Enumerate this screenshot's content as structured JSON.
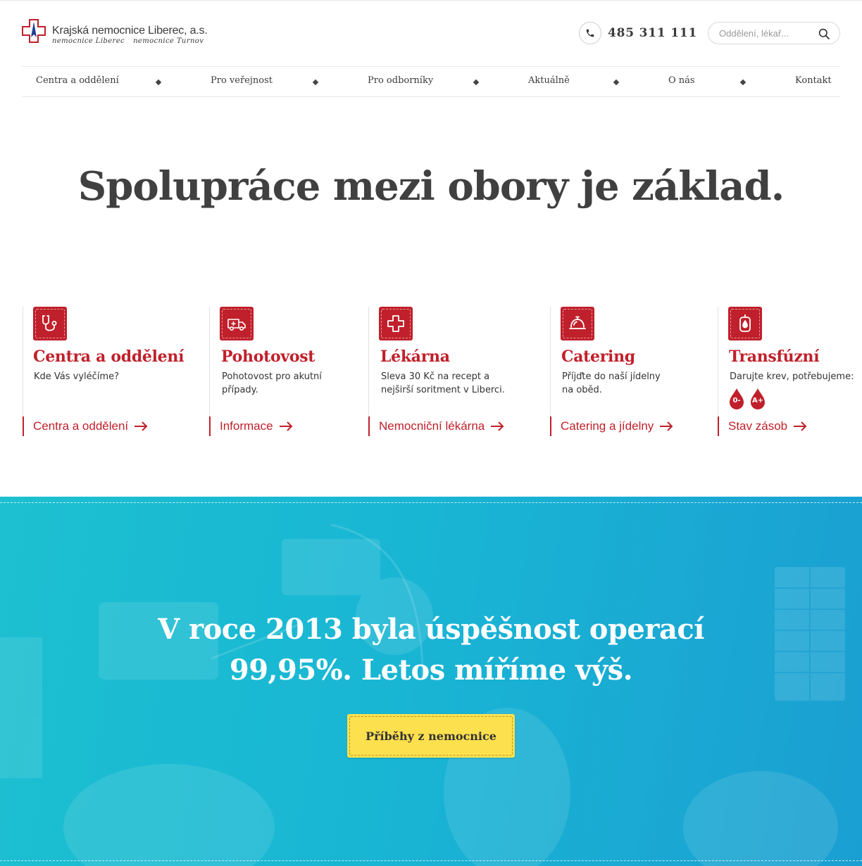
{
  "header": {
    "logo_title": "Krajská nemocnice Liberec, a.s.",
    "logo_sub": [
      "nemocnice Liberec",
      "nemocnice Turnov"
    ],
    "phone": "485 311 111",
    "search_placeholder": "Oddělení, lékař..."
  },
  "nav": {
    "items": [
      {
        "label": "Centra a oddělení"
      },
      {
        "label": "Pro veřejnost"
      },
      {
        "label": "Pro odborníky"
      },
      {
        "label": "Aktuálně"
      },
      {
        "label": "O nás"
      },
      {
        "label": "Kontakt"
      }
    ]
  },
  "hero": {
    "title": "Spolupráce mezi obory je základ."
  },
  "cards": [
    {
      "icon": "stethoscope-icon",
      "title": "Centra a oddělení",
      "desc": [
        "Kde Vás vyléčíme?"
      ],
      "link": "Centra a oddělení"
    },
    {
      "icon": "ambulance-icon",
      "title": "Pohotovost",
      "desc": [
        "Pohotovost pro akutní",
        "případy."
      ],
      "link": "Informace"
    },
    {
      "icon": "medical-cross-icon",
      "title": "Lékárna",
      "desc": [
        "Sleva 30 Kč na recept a",
        "nejširší soritment v Liberci."
      ],
      "link": "Nemocniční lékárna"
    },
    {
      "icon": "cloche-icon",
      "title": "Catering",
      "desc": [
        "Příjďte do naší jídelny",
        "na oběd."
      ],
      "link": "Catering a jídelny"
    },
    {
      "icon": "blood-bag-icon",
      "title": "Transfúzní",
      "desc": [
        "Darujte krev, potřebujeme:"
      ],
      "link": "Stav zásob",
      "blood_types": [
        "0-",
        "A+"
      ]
    }
  ],
  "banner": {
    "title_line1": "V roce 2013 byla úspěšnost operací",
    "title_line2": "99,95%. Letos míříme výš.",
    "button": "Příběhy z nemocnice"
  },
  "colors": {
    "brand_red": "#c0202b",
    "banner_cyan": "#19b6d4",
    "button_yellow": "#fde04e",
    "logo_blue": "#1f3f93"
  }
}
